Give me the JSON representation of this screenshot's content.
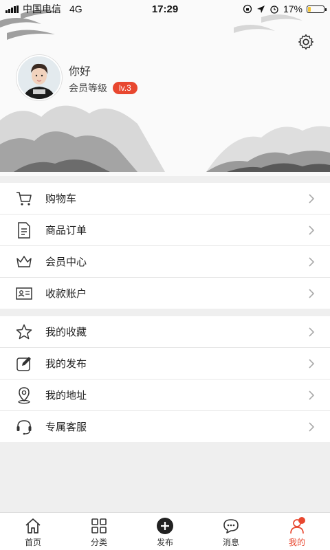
{
  "status": {
    "carrier": "中国电信",
    "network": "4G",
    "time": "17:29",
    "battery": "17%",
    "battery_level": 0.17
  },
  "profile": {
    "greeting": "你好",
    "level_label": "会员等级",
    "level_badge": "lv.3"
  },
  "menu_group_1": [
    {
      "label": "购物车",
      "icon": "cart-icon"
    },
    {
      "label": "商品订单",
      "icon": "order-document-icon"
    },
    {
      "label": "会员中心",
      "icon": "crown-icon"
    },
    {
      "label": "收款账户",
      "icon": "id-card-icon"
    }
  ],
  "menu_group_2": [
    {
      "label": "我的收藏",
      "icon": "star-icon"
    },
    {
      "label": "我的发布",
      "icon": "edit-icon"
    },
    {
      "label": "我的地址",
      "icon": "location-pin-icon"
    },
    {
      "label": "专属客服",
      "icon": "headset-icon"
    }
  ],
  "tabs": [
    {
      "label": "首页",
      "icon": "home-icon"
    },
    {
      "label": "分类",
      "icon": "grid-icon"
    },
    {
      "label": "发布",
      "icon": "plus-circle-icon"
    },
    {
      "label": "消息",
      "icon": "chat-bubble-icon"
    },
    {
      "label": "我的",
      "icon": "user-icon",
      "active": true
    }
  ],
  "colors": {
    "accent": "#e8472f",
    "background": "#efefef"
  }
}
